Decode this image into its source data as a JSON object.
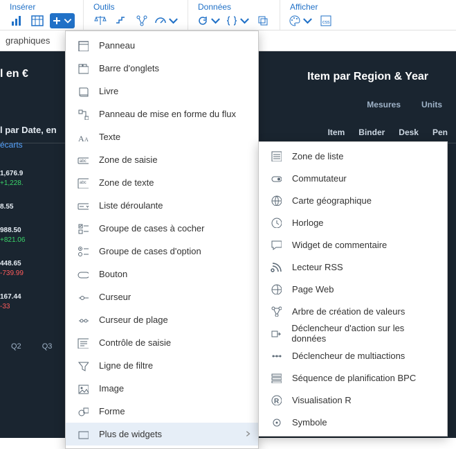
{
  "menu": {
    "insert": "Insérer",
    "tools": "Outils",
    "data": "Données",
    "view": "Afficher"
  },
  "ribbon2": {
    "tab": "graphiques"
  },
  "canvas": {
    "left_title_suffix": "l en €",
    "right_title_suffix": "Item par Region & Year",
    "mesures": "Mesures",
    "units": "Units",
    "item": "Item",
    "binder": "Binder",
    "desk": "Desk",
    "pen": "Pen",
    "sub2": "l par Date, en",
    "link": "écarts",
    "nums": [
      {
        "v": "1,676.9",
        "d": "+1,228.",
        "cls": "pos"
      },
      {
        "v": "8.55",
        "d": "",
        "cls": ""
      },
      {
        "v": "988.50",
        "d": "+821.06",
        "cls": "pos"
      },
      {
        "v": "448.65",
        "d": "-739.99",
        "cls": "neg"
      },
      {
        "v": "167.44",
        "d": "-33",
        "cls": "neg"
      }
    ],
    "xaxis": [
      "Q2",
      "Q3"
    ]
  },
  "dropdown": [
    {
      "icon": "panel",
      "label": "Panneau"
    },
    {
      "icon": "tabstrip",
      "label": "Barre d'onglets"
    },
    {
      "icon": "book",
      "label": "Livre"
    },
    {
      "icon": "flow",
      "label": "Panneau de mise en forme du flux"
    },
    {
      "icon": "text-aa",
      "label": "Texte"
    },
    {
      "icon": "input",
      "label": "Zone de saisie"
    },
    {
      "icon": "textarea",
      "label": "Zone de texte"
    },
    {
      "icon": "dropdown",
      "label": "Liste déroulante"
    },
    {
      "icon": "checkboxes",
      "label": "Groupe de cases à cocher"
    },
    {
      "icon": "radios",
      "label": "Groupe de cases d'option"
    },
    {
      "icon": "button",
      "label": "Bouton"
    },
    {
      "icon": "slider",
      "label": "Curseur"
    },
    {
      "icon": "range",
      "label": "Curseur de plage"
    },
    {
      "icon": "input-ctrl",
      "label": "Contrôle de saisie"
    },
    {
      "icon": "filter",
      "label": "Ligne de filtre"
    },
    {
      "icon": "image",
      "label": "Image"
    },
    {
      "icon": "shape",
      "label": "Forme"
    },
    {
      "icon": "more",
      "label": "Plus de widgets",
      "submenu": true,
      "hovered": true
    }
  ],
  "submenu": [
    {
      "icon": "listbox",
      "label": "Zone de liste"
    },
    {
      "icon": "switch",
      "label": "Commutateur"
    },
    {
      "icon": "geomap",
      "label": "Carte géographique"
    },
    {
      "icon": "clock",
      "label": "Horloge"
    },
    {
      "icon": "comment",
      "label": "Widget de commentaire"
    },
    {
      "icon": "rss",
      "label": "Lecteur RSS"
    },
    {
      "icon": "web",
      "label": "Page Web"
    },
    {
      "icon": "tree",
      "label": "Arbre de création de valeurs"
    },
    {
      "icon": "dat-trigger",
      "label": "Déclencheur d'action sur les données"
    },
    {
      "icon": "multi-trigger",
      "label": "Déclencheur de multiactions"
    },
    {
      "icon": "bpc",
      "label": "Séquence de planification BPC"
    },
    {
      "icon": "rviz",
      "label": "Visualisation R"
    },
    {
      "icon": "symbol",
      "label": "Symbole"
    }
  ]
}
